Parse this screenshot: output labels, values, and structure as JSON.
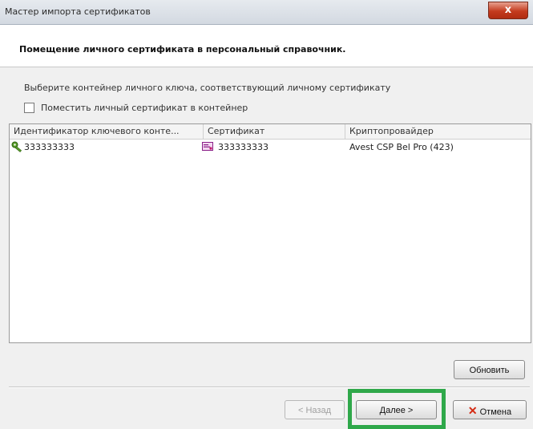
{
  "window": {
    "title": "Мастер импорта сертификатов",
    "close_glyph": "x"
  },
  "header": {
    "title": "Помещение личного сертификата в персональный справочник."
  },
  "instruction": "Выберите контейнер личного ключа, соответствующий личному сертификату",
  "checkbox": {
    "label": "Поместить личный сертификат в контейнер",
    "checked": false
  },
  "list": {
    "columns": [
      "Идентификатор ключевого конте...",
      "Сертификат",
      "Криптопровайдер"
    ],
    "rows": [
      {
        "container": "333333333",
        "certificate": "333333333",
        "provider": "Avest CSP Bel Pro (423)",
        "container_icon": "key-icon",
        "certificate_icon": "certificate-icon"
      }
    ]
  },
  "buttons": {
    "refresh": "Обновить",
    "back": "< Назад",
    "next": "Далее >",
    "cancel": "Отмена",
    "cancel_icon": "red-x-icon"
  },
  "colors": {
    "highlight": "#2fa84a",
    "cancel_x": "#d42a12"
  }
}
